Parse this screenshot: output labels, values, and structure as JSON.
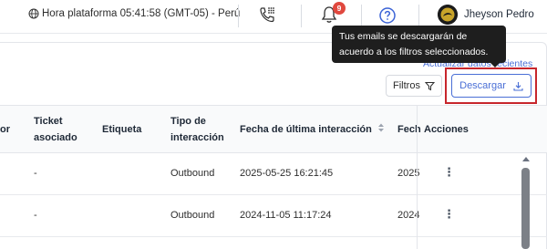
{
  "header": {
    "timezone_text": "Hora plataforma 05:41:58 (GMT-05) - Perú",
    "notification_count": "9",
    "user_name": "Jheyson Pedro"
  },
  "tooltip": {
    "text": "Tus emails se descargarán de acuerdo a los filtros seleccionados."
  },
  "toolbar": {
    "update_link": "Actualizar datos recientes",
    "filters_label": "Filtros",
    "download_label": "Descargar"
  },
  "table": {
    "columns": {
      "col_partial": "or",
      "ticket": "Ticket asociado",
      "label": "Etiqueta",
      "interaction_type": "Tipo de interacción",
      "last_interaction": "Fecha de última interacción",
      "next_partial": "Fech",
      "actions": "Acciones"
    },
    "rows": [
      {
        "ticket": "-",
        "label": "",
        "interaction_type": "Outbound",
        "last_interaction": "2025-05-25 16:21:45",
        "next_partial": "2025"
      },
      {
        "ticket": "-",
        "label": "",
        "interaction_type": "Outbound",
        "last_interaction": "2024-11-05 11:17:24",
        "next_partial": "2024"
      }
    ]
  },
  "icons": {
    "timezone": "globe-icon",
    "phone": "dialpad-phone-icon",
    "notifications": "bell-icon",
    "help": "question-circle-icon",
    "filters": "funnel-icon",
    "download": "download-icon",
    "sort": "sort-icon",
    "row_actions": "kebab-menu-icon"
  },
  "colors": {
    "accent": "#4a6fd6",
    "badge": "#e0483e",
    "highlight": "#c7262c",
    "tooltip_bg": "#1e1e1e"
  }
}
